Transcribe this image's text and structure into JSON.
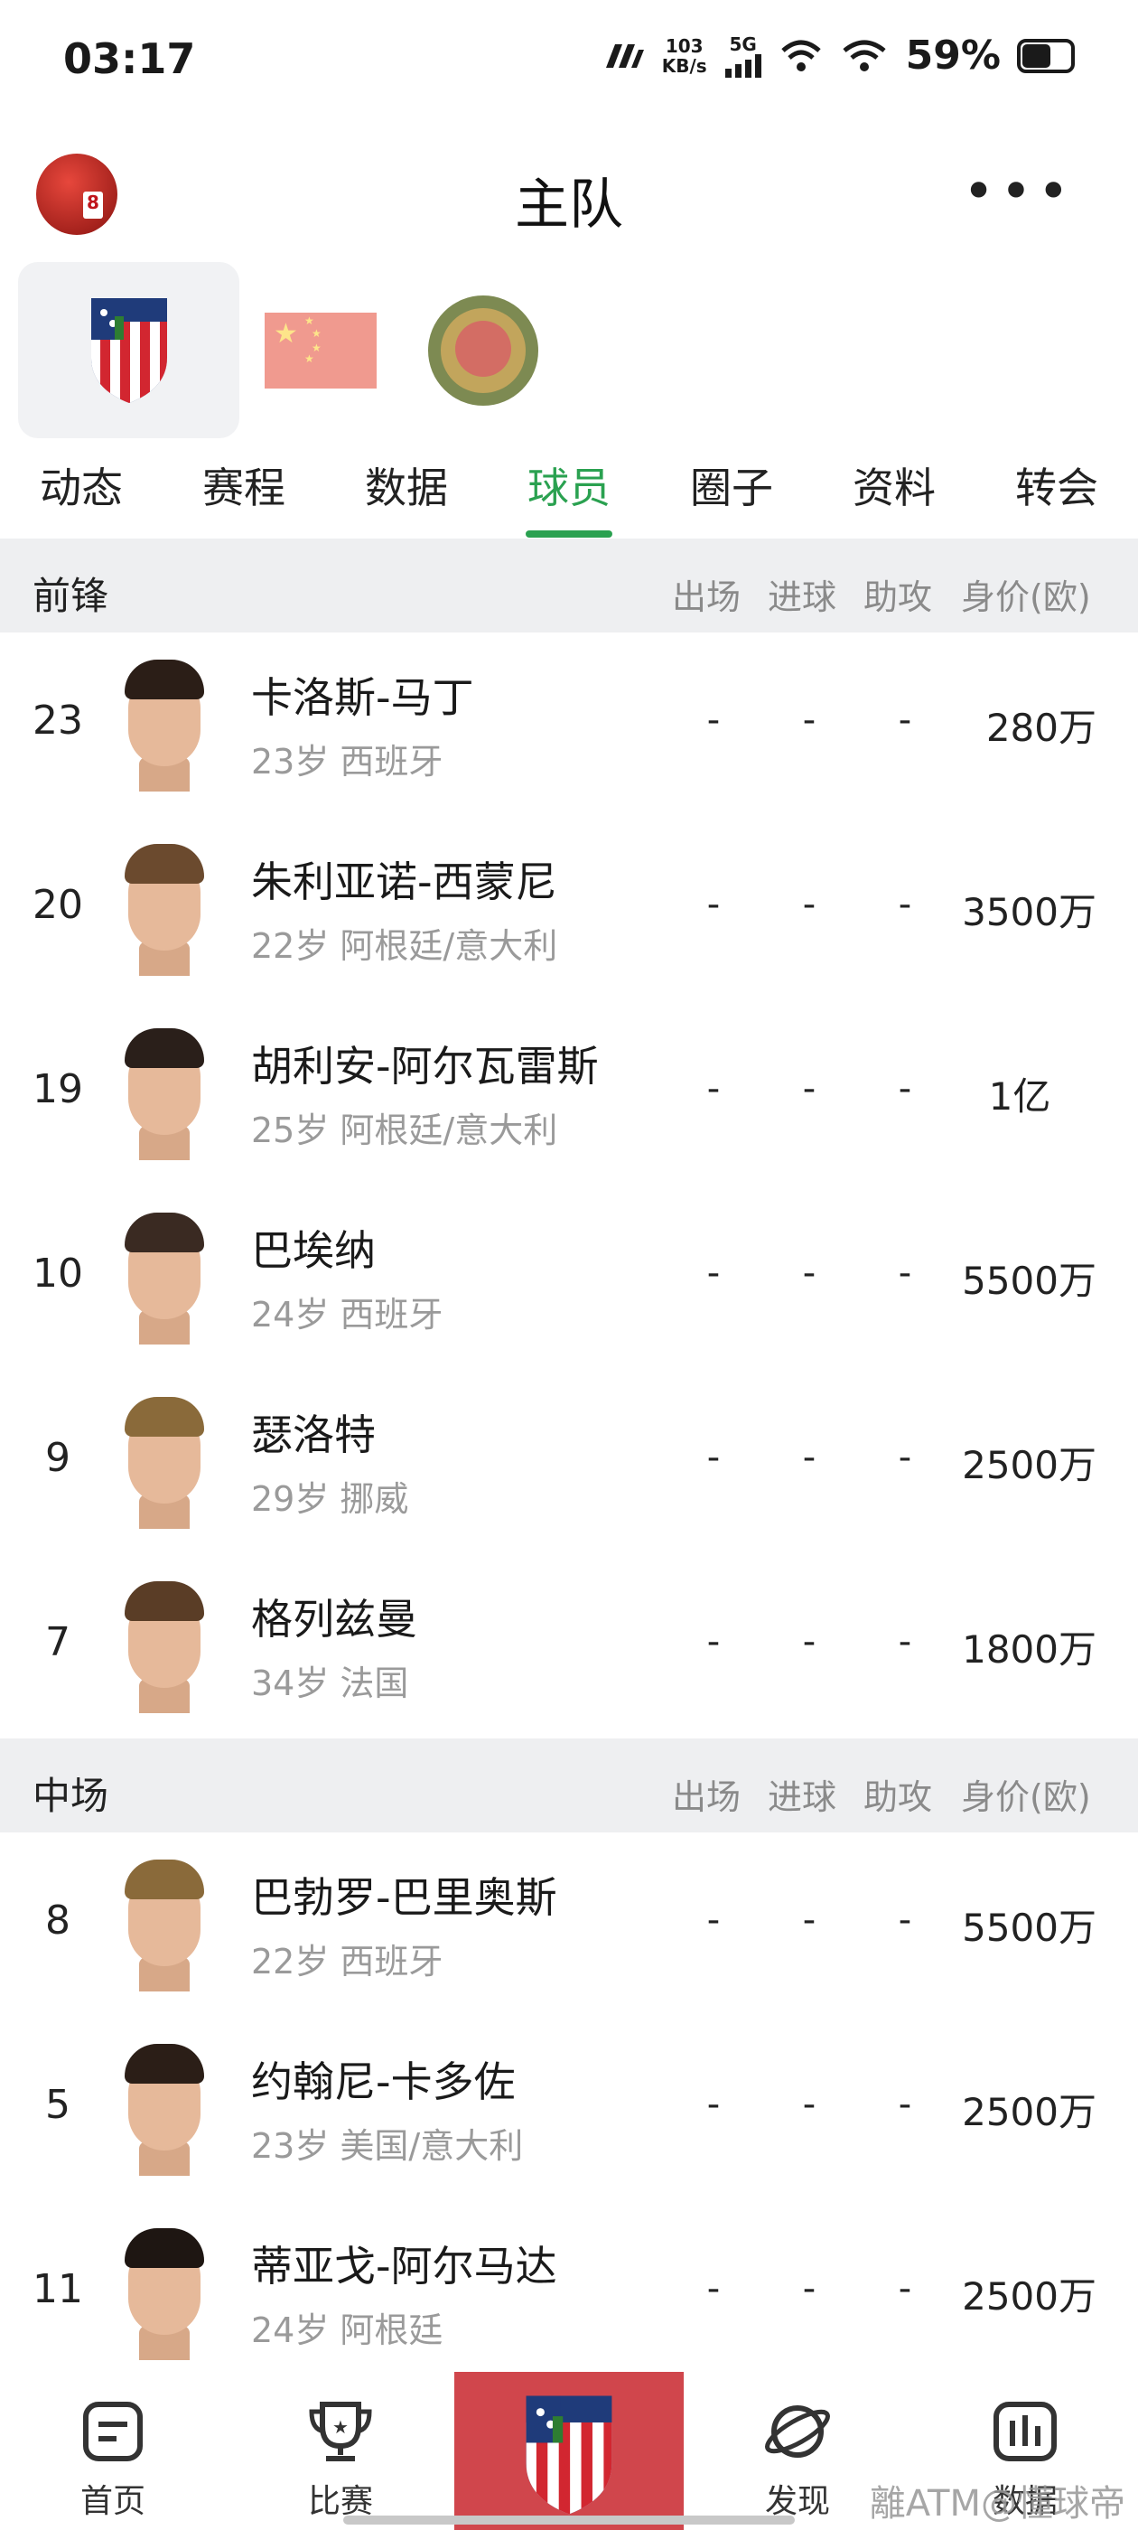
{
  "status_bar": {
    "time": "03:17",
    "net_speed_value": "103",
    "net_speed_unit": "KB/s",
    "network_type": "5G",
    "battery_text": "59%",
    "battery_level": 0.59
  },
  "header": {
    "title": "主队",
    "more_icon": "more-horizontal-icon"
  },
  "teams": [
    {
      "name": "atletico-madrid-crest",
      "active": true
    },
    {
      "name": "china-flag",
      "active": false
    },
    {
      "name": "football-club-crest",
      "active": false
    }
  ],
  "tabs": [
    {
      "label": "动态",
      "active": false
    },
    {
      "label": "赛程",
      "active": false
    },
    {
      "label": "数据",
      "active": false
    },
    {
      "label": "球员",
      "active": true
    },
    {
      "label": "圈子",
      "active": false
    },
    {
      "label": "资料",
      "active": false
    },
    {
      "label": "转会",
      "active": false
    }
  ],
  "columns": {
    "apps": "出场",
    "goals": "进球",
    "assists": "助攻",
    "value": "身价(欧)"
  },
  "sections": [
    {
      "label": "前锋",
      "players": [
        {
          "number": "23",
          "name": "卡洛斯-马丁",
          "meta": "23岁 西班牙",
          "apps": "-",
          "goals": "-",
          "assists": "-",
          "value": "280万"
        },
        {
          "number": "20",
          "name": "朱利亚诺-西蒙尼",
          "meta": "22岁 阿根廷/意大利",
          "apps": "-",
          "goals": "-",
          "assists": "-",
          "value": "3500万"
        },
        {
          "number": "19",
          "name": "胡利安-阿尔瓦雷斯",
          "meta": "25岁 阿根廷/意大利",
          "apps": "-",
          "goals": "-",
          "assists": "-",
          "value": "1亿"
        },
        {
          "number": "10",
          "name": "巴埃纳",
          "meta": "24岁 西班牙",
          "apps": "-",
          "goals": "-",
          "assists": "-",
          "value": "5500万"
        },
        {
          "number": "9",
          "name": "瑟洛特",
          "meta": "29岁 挪威",
          "apps": "-",
          "goals": "-",
          "assists": "-",
          "value": "2500万"
        },
        {
          "number": "7",
          "name": "格列兹曼",
          "meta": "34岁 法国",
          "apps": "-",
          "goals": "-",
          "assists": "-",
          "value": "1800万"
        }
      ]
    },
    {
      "label": "中场",
      "players": [
        {
          "number": "8",
          "name": "巴勃罗-巴里奥斯",
          "meta": "22岁 西班牙",
          "apps": "-",
          "goals": "-",
          "assists": "-",
          "value": "5500万"
        },
        {
          "number": "5",
          "name": "约翰尼-卡多佐",
          "meta": "23岁 美国/意大利",
          "apps": "-",
          "goals": "-",
          "assists": "-",
          "value": "2500万"
        },
        {
          "number": "11",
          "name": "蒂亚戈-阿尔马达",
          "meta": "24岁 阿根廷",
          "apps": "-",
          "goals": "-",
          "assists": "-",
          "value": "2500万"
        }
      ]
    }
  ],
  "bottom_nav": [
    {
      "label": "首页",
      "icon": "home-icon"
    },
    {
      "label": "比赛",
      "icon": "trophy-icon"
    },
    {
      "label": "",
      "icon": "team-crest-icon"
    },
    {
      "label": "发现",
      "icon": "planet-icon"
    },
    {
      "label": "数据",
      "icon": "bar-chart-icon"
    }
  ],
  "watermark": "離ATM@懂球帝",
  "colors": {
    "accent": "#2aa150",
    "section_bg": "#eeeff1",
    "nav_center": "#d0464c"
  }
}
